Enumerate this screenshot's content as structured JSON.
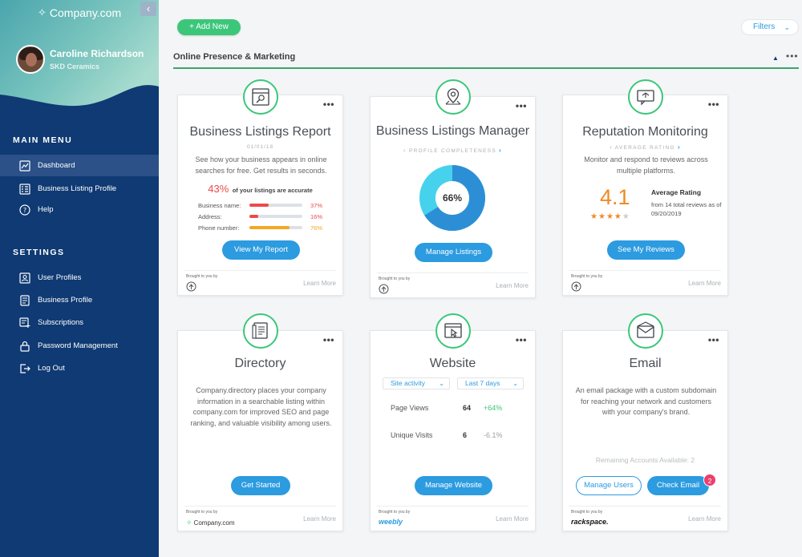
{
  "sidebar": {
    "logo": "Company.com",
    "collapse_icon": "chevron-left-icon",
    "user_name": "Caroline Richardson",
    "user_company": "SKD Ceramics",
    "main_menu_title": "MAIN MENU",
    "main_items": [
      {
        "label": "Dashboard",
        "icon": "dashboard-icon",
        "active": true
      },
      {
        "label": "Business Listing Profile",
        "icon": "list-icon"
      },
      {
        "label": "Help",
        "icon": "help-icon"
      }
    ],
    "settings_title": "SETTINGS",
    "settings_items": [
      {
        "label": "User Profiles",
        "icon": "user-icon"
      },
      {
        "label": "Business Profile",
        "icon": "document-icon"
      },
      {
        "label": "Subscriptions",
        "icon": "subscription-icon"
      },
      {
        "label": "Password Management",
        "icon": "lock-icon"
      },
      {
        "label": "Log Out",
        "icon": "logout-icon"
      }
    ],
    "colors": {
      "nav_bg": "#0f3a73",
      "active_bg": "#2b5188",
      "header_teal": "#5fb3b3"
    }
  },
  "toolbar": {
    "add_label": "+ Add New",
    "filters_label": "Filters",
    "filters_icon": "chevron-down-icon"
  },
  "section": {
    "title": "Online Presence & Marketing",
    "collapse_icon": "caret-up-icon",
    "more": "•••"
  },
  "common": {
    "more": "•••",
    "brought": "Brought to you by",
    "learn": "Learn More"
  },
  "cards": {
    "listings_report": {
      "icon": "search-listing-icon",
      "title": "Business Listings Report",
      "date": "01/01/18",
      "desc": "See how your business appears in online searches for free. Get results in seconds.",
      "accuracy_value": "43%",
      "accuracy_label": "of your listings are accurate",
      "bars": [
        {
          "label": "Business name:",
          "value": "37%",
          "fraction": 0.37,
          "color": "#ec4a4a"
        },
        {
          "label": "Address:",
          "value": "16%",
          "fraction": 0.16,
          "color": "#ec4a4a"
        },
        {
          "label": "Phone number:",
          "value": "76%",
          "fraction": 0.76,
          "color": "#f5a623"
        }
      ],
      "button": "View My Report",
      "provider_icon": "company-badge-icon"
    },
    "listings_manager": {
      "icon": "location-pin-icon",
      "title": "Business Listings Manager",
      "subtitle": "PROFILE COMPLETENESS",
      "completeness": 0.66,
      "completeness_label": "66%",
      "ring_colors": {
        "filled": "#2c8fd6",
        "remaining": "#46d2ec"
      },
      "button": "Manage Listings",
      "provider_icon": "company-badge-icon"
    },
    "reputation": {
      "icon": "reviews-chat-icon",
      "title": "Reputation Monitoring",
      "subtitle": "AVERAGE RATING",
      "desc": "Monitor and respond to reviews across multiple platforms.",
      "rating": "4.1",
      "rating_label": "Average Rating",
      "rating_detail": "from 14 total reviews as of 09/20/2019",
      "stars_filled": 4,
      "stars_total": 5,
      "button": "See My Reviews",
      "provider_icon": "company-badge-icon"
    },
    "directory": {
      "icon": "directory-icon",
      "title": "Directory",
      "desc": "Company.directory places your company information in a searchable listing within company.com for improved SEO and page ranking, and valuable visibility among users.",
      "button": "Get Started",
      "provider_logo": "Company.com",
      "provider_icon": "company-logo-icon"
    },
    "website": {
      "icon": "browser-cursor-icon",
      "title": "Website",
      "dropdown_activity": "Site activity",
      "dropdown_range": "Last 7 days",
      "stats": [
        {
          "label": "Page Views",
          "value": "64",
          "change": "+64%",
          "color": "#3cc67a"
        },
        {
          "label": "Unique Visits",
          "value": "6",
          "change": "-6.1%",
          "color": "#9aa0a6"
        }
      ],
      "button": "Manage Website",
      "provider_logo": "weebly"
    },
    "email": {
      "icon": "envelope-icon",
      "title": "Email",
      "desc": "An email package with a custom subdomain for reaching your network and customers with your company's brand.",
      "remaining": "Remaining Accounts Available: 2",
      "button_users": "Manage Users",
      "button_check": "Check Email",
      "badge": "2",
      "provider_logo": "rackspace."
    }
  }
}
